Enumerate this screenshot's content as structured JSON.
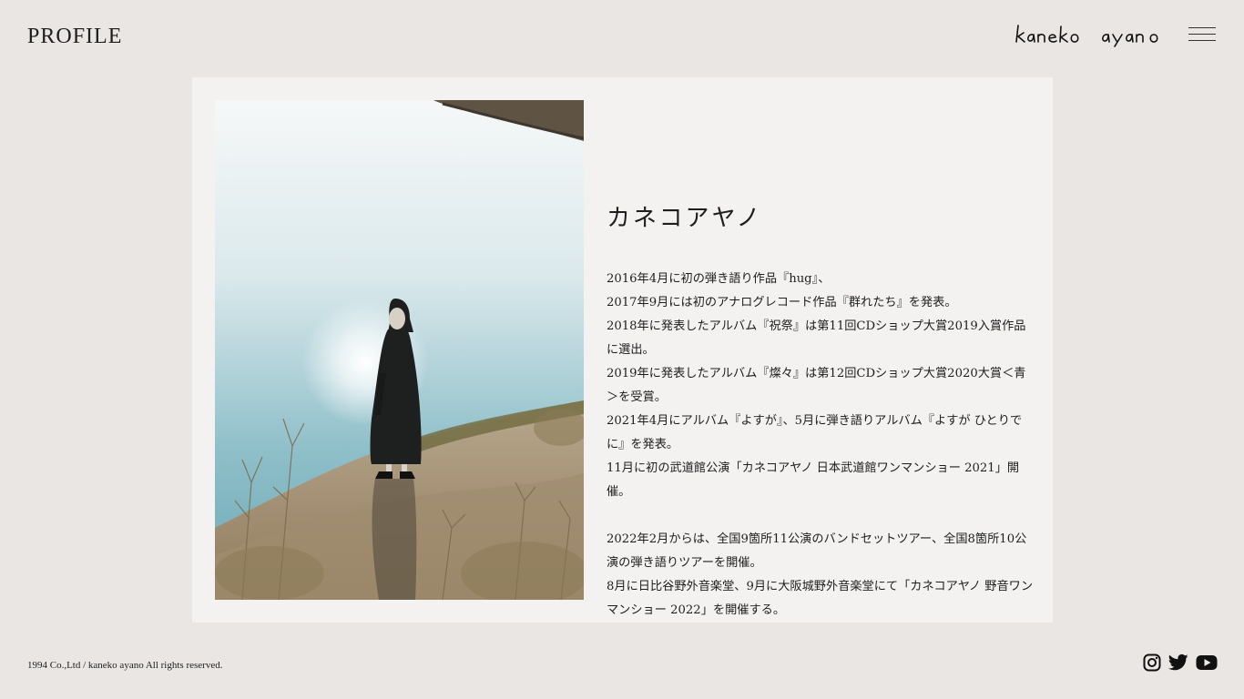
{
  "header": {
    "page_title": "PROFILE",
    "logo_text": "kaneko ayano"
  },
  "profile": {
    "name": "カネコアヤノ",
    "paragraphs": [
      "2016年4月に初の弾き語り作品『hug』、",
      "2017年9月には初のアナログレコード作品『群れたち』を発表。",
      "2018年に発表したアルバム『祝祭』は第11回CDショップ大賞2019入賞作品に選出。",
      "2019年に発表したアルバム『燦々』は第12回CDショップ大賞2020大賞＜青＞を受賞。",
      "2021年4月にアルバム『よすが』、5月に弾き語りアルバム『よすが ひとりでに』を発表。",
      "11月に初の武道館公演「カネコアヤノ 日本武道館ワンマンショー 2021」開催。",
      "",
      "2022年2月からは、全国9箇所11公演のバンドセットツアー、全国8箇所10公演の弾き語りツアーを開催。",
      "8月に日比谷野外音楽堂、9月に大阪城野外音楽堂にて「カネコアヤノ 野音ワンマンショー 2022」を開催する。"
    ]
  },
  "footer": {
    "copyright": "1994 Co.,Ltd / kaneko ayano All rights reserved.",
    "social": [
      "instagram-icon",
      "twitter-icon",
      "youtube-icon"
    ]
  },
  "colors": {
    "background": "#e9e6e4",
    "card": "#f4f2f1",
    "text": "#1e1e1e"
  }
}
